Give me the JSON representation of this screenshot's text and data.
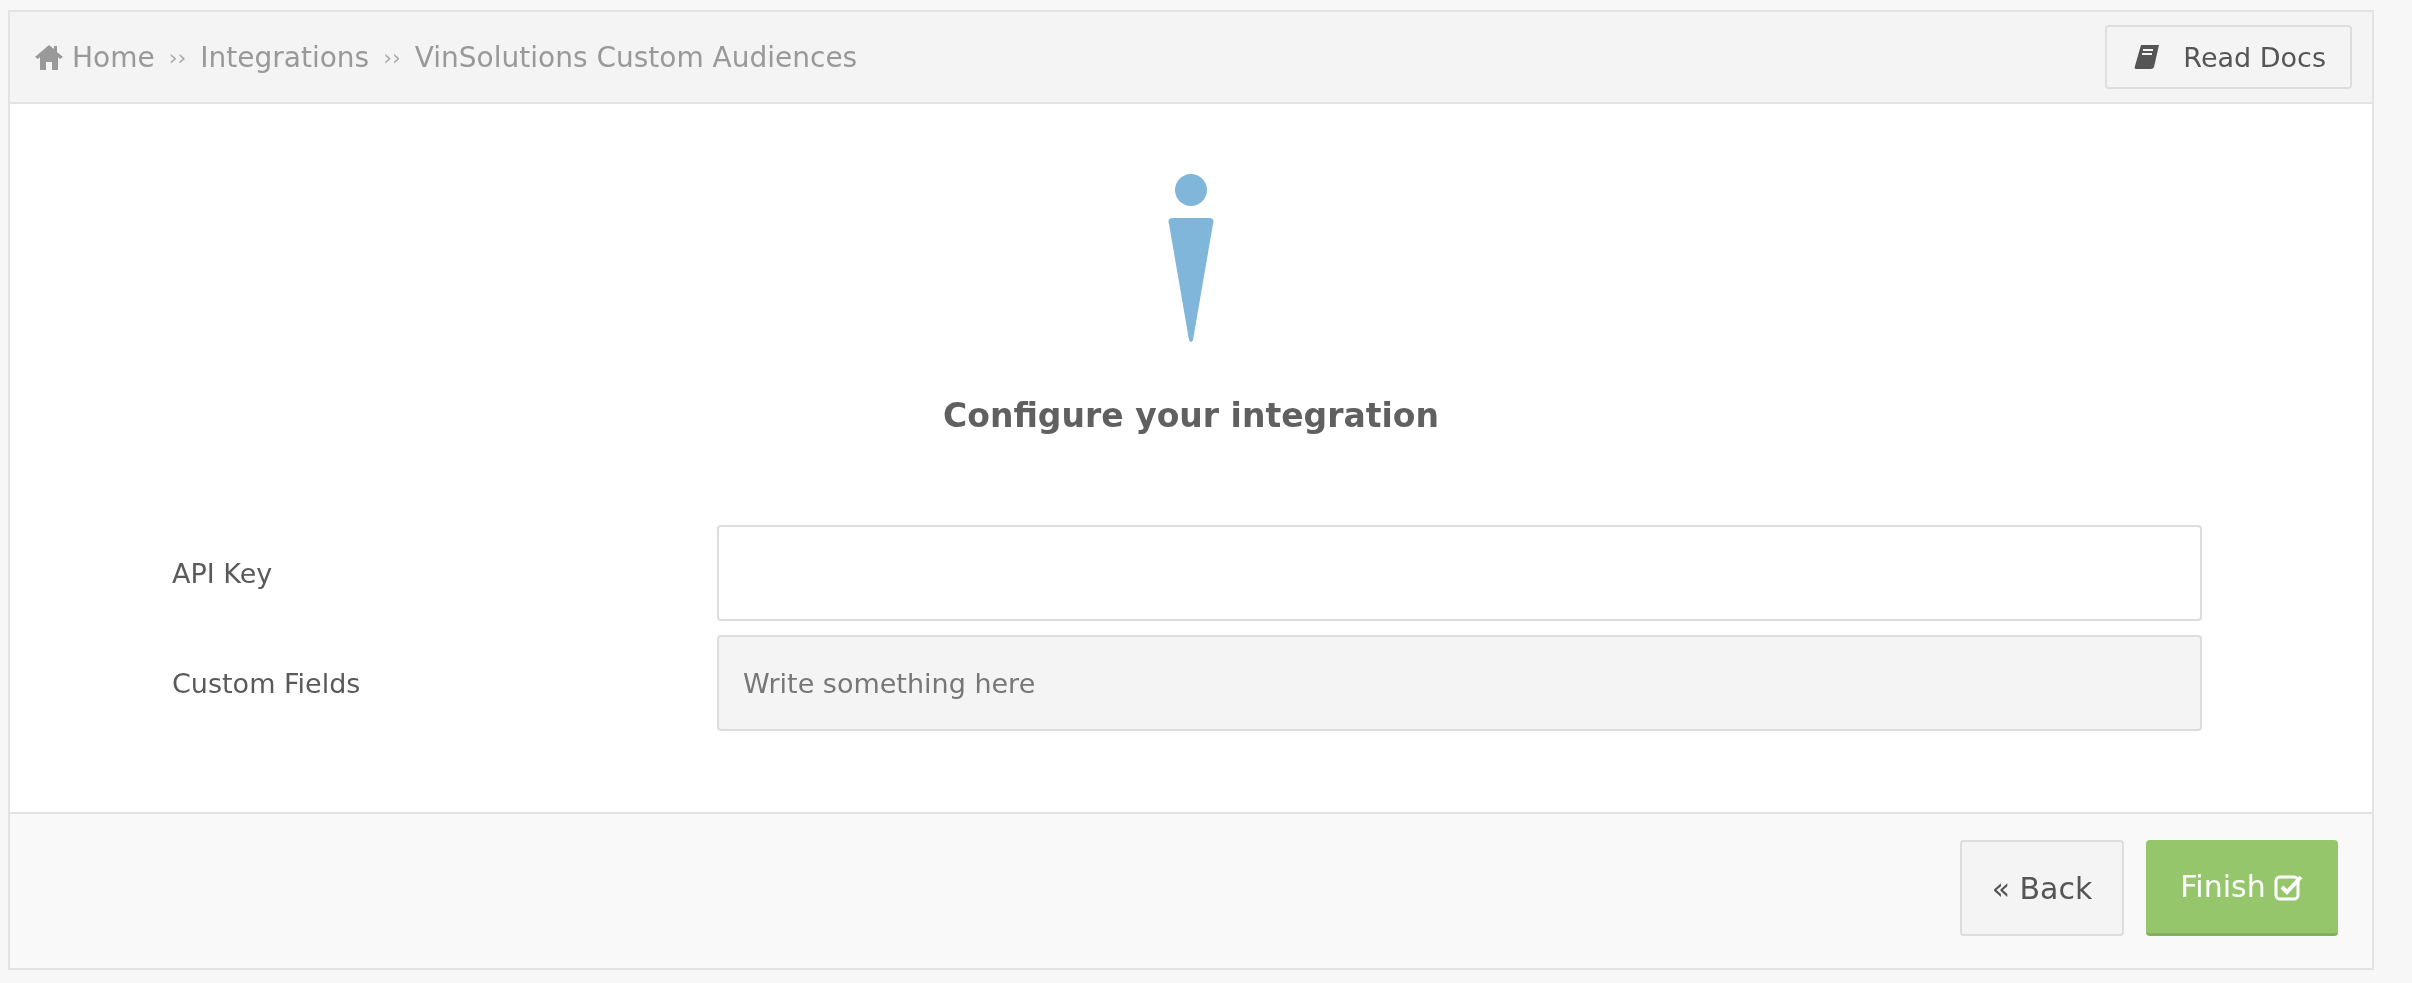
{
  "breadcrumb": [
    {
      "kind": "home",
      "label": "Home"
    },
    {
      "kind": "separator",
      "label": "››"
    },
    {
      "kind": "link",
      "label": "Integrations"
    },
    {
      "kind": "separator",
      "label": "››"
    },
    {
      "kind": "current",
      "label": "VinSolutions Custom Audiences"
    }
  ],
  "docs_button": {
    "label": "Read Docs"
  },
  "heading": "Configure your integration",
  "fields": [
    {
      "label": "API Key",
      "kind": "input"
    },
    {
      "label": "Custom Fields",
      "placeholder": "Write something here",
      "kind": "textarea"
    }
  ],
  "footer": {
    "back": {
      "glyph": "«",
      "label": "Back"
    },
    "finish": {
      "label": "Finish"
    }
  }
}
